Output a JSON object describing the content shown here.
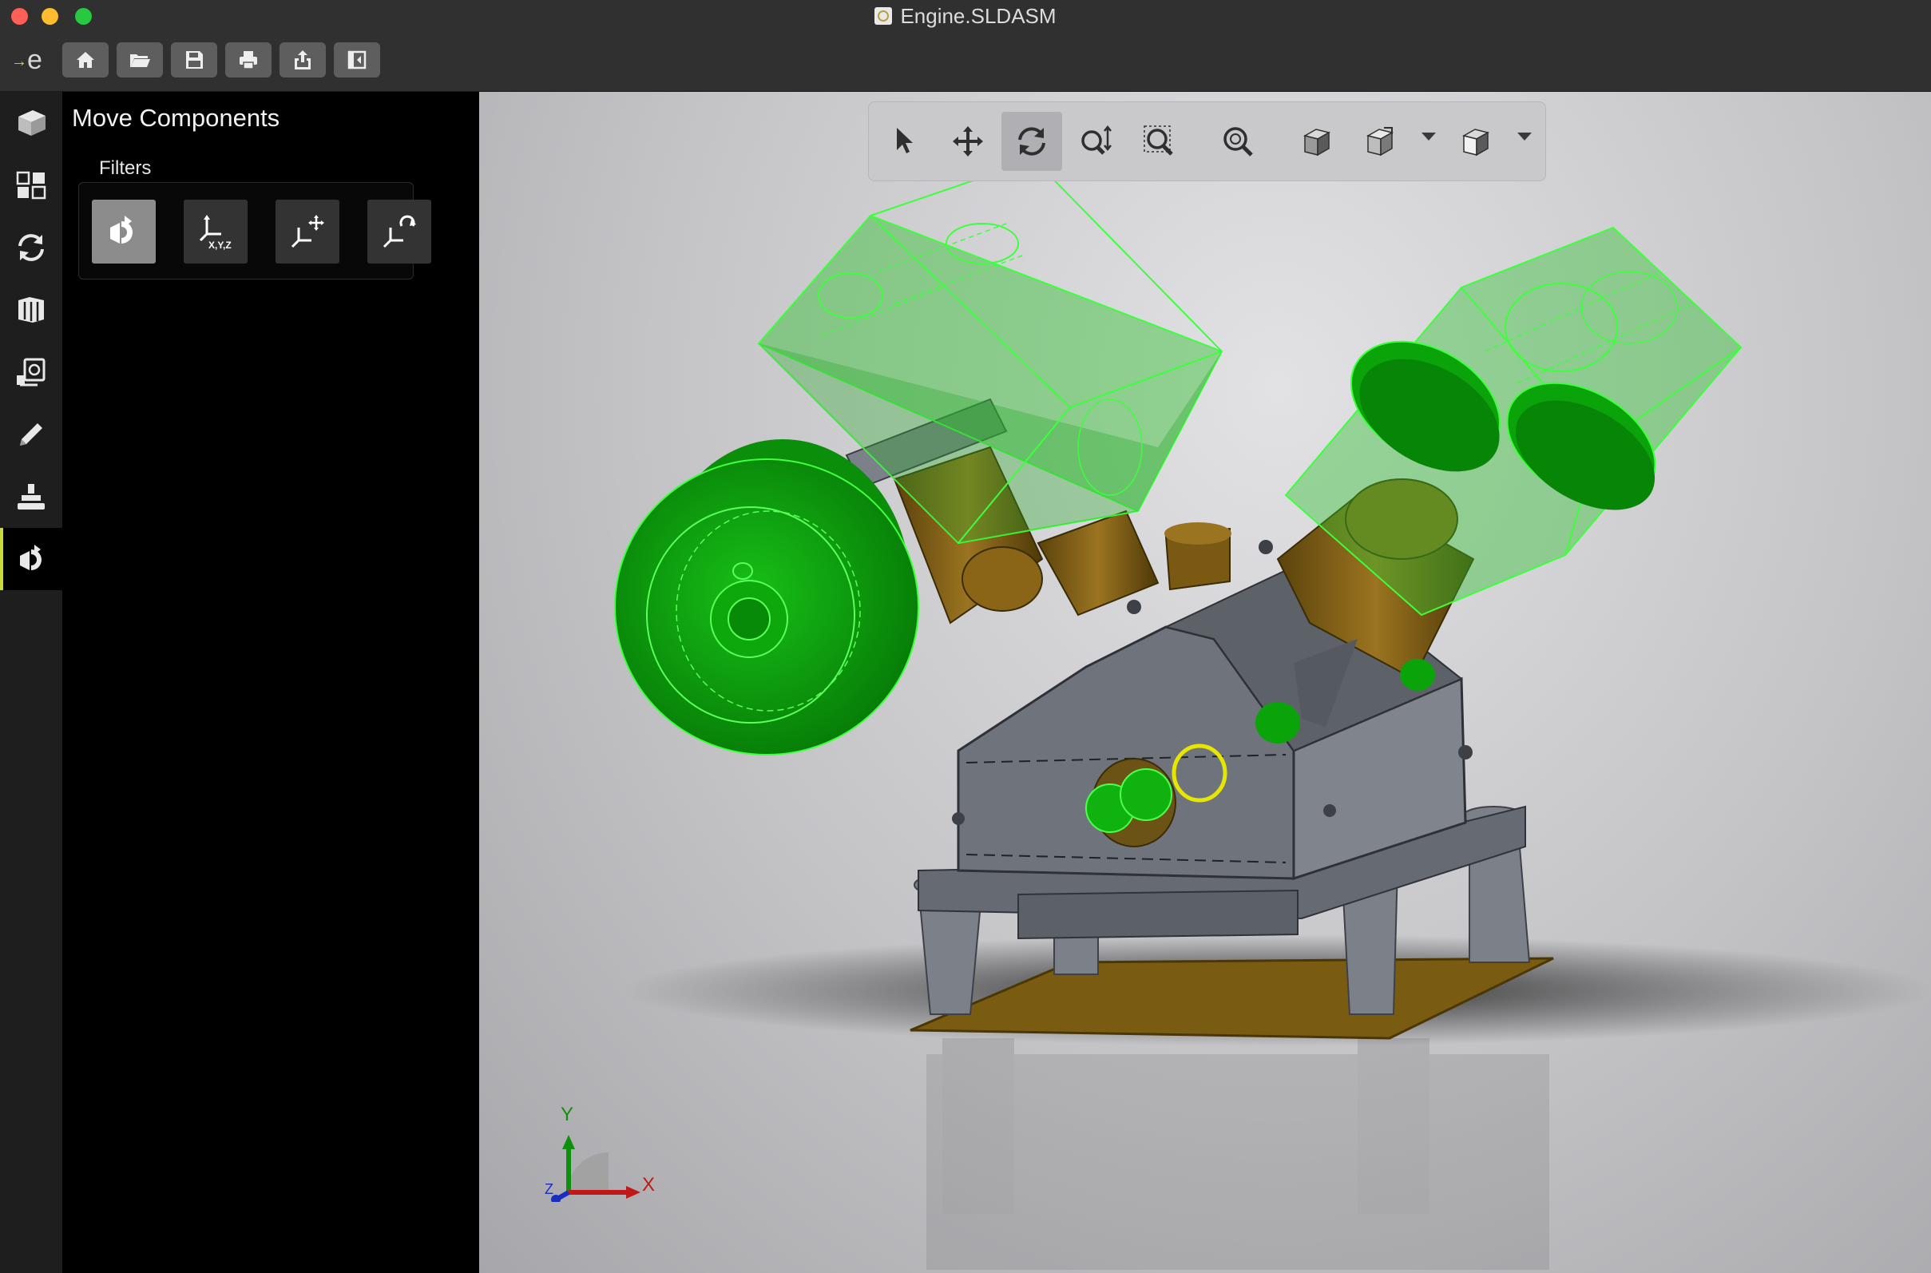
{
  "window": {
    "title": "Engine.SLDASM",
    "file_icon": "assembly-file-icon"
  },
  "toolbar": {
    "logo_text": "e",
    "logo_arrow": "→",
    "buttons": [
      "home-icon",
      "open-folder-icon",
      "save-icon",
      "print-icon",
      "share-icon",
      "sidebar-toggle-icon"
    ]
  },
  "rail": {
    "items": [
      "parts-icon",
      "layout-icon",
      "update-icon",
      "components-icon",
      "drawing-icon",
      "sketch-pencil-icon",
      "stamp-icon",
      "move-component-icon"
    ],
    "active_index": 7
  },
  "panel": {
    "title": "Move Components",
    "filters_label": "Filters",
    "filters": [
      {
        "icon": "free-drag-icon",
        "selected": true
      },
      {
        "icon": "xyz-translate-icon",
        "label": "X,Y,Z",
        "selected": false
      },
      {
        "icon": "along-entity-icon",
        "selected": false
      },
      {
        "icon": "rotate-about-icon",
        "selected": false
      }
    ]
  },
  "view_toolbar": {
    "tools": [
      "select-icon",
      "pan-icon",
      "rotate-icon",
      "zoom-icon",
      "zoom-to-area-icon",
      "zoom-to-fit-icon",
      "display-style-icon",
      "view-orientation-icon",
      "section-view-icon"
    ],
    "active_tool": "rotate-icon"
  },
  "triad": {
    "x_label": "X",
    "y_label": "Y",
    "z_label": "Z"
  },
  "colors": {
    "accent": "#c9d83a",
    "selection_green": "#0ca80c",
    "preselect_yellow": "#e6e600",
    "body_gray": "#6f747c",
    "brass": "#7a5b12"
  }
}
